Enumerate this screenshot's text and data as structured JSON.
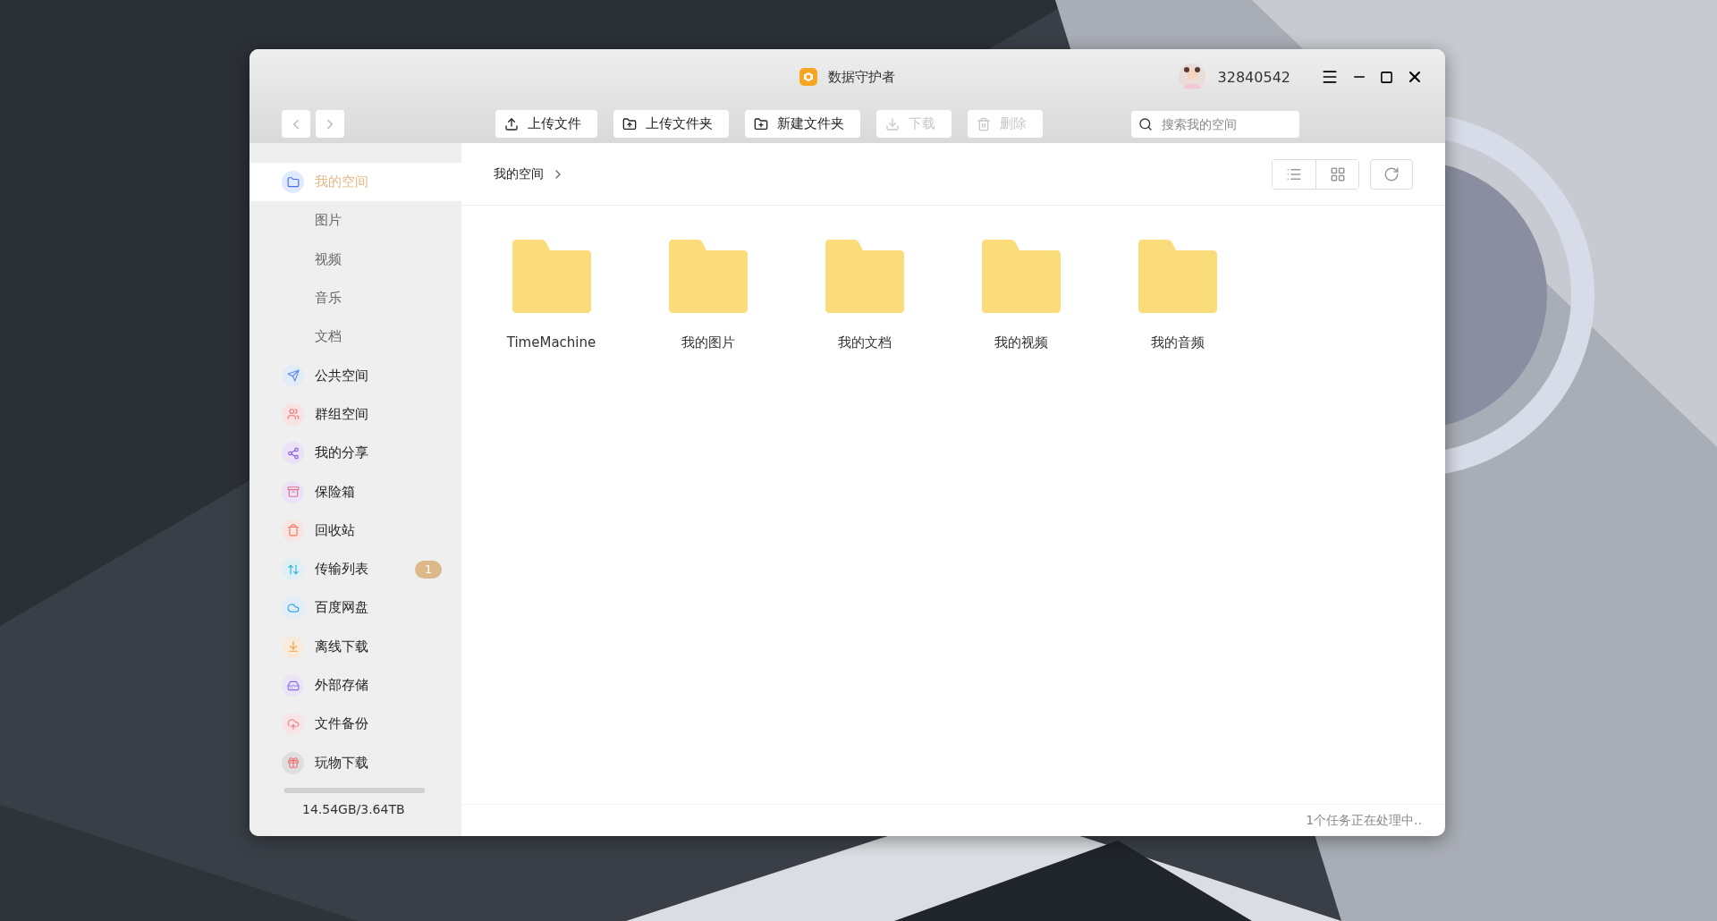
{
  "window": {
    "title": "数据守护者",
    "user": "32840542"
  },
  "toolbar": {
    "buttons": [
      {
        "label": "上传文件",
        "kind": "upload",
        "disabled": false
      },
      {
        "label": "上传文件夹",
        "kind": "upload-folder",
        "disabled": false
      },
      {
        "label": "新建文件夹",
        "kind": "new-folder",
        "disabled": false
      },
      {
        "label": "下载",
        "kind": "download",
        "disabled": true
      },
      {
        "label": "删除",
        "kind": "delete",
        "disabled": true
      }
    ],
    "search": {
      "placeholder": "搜索我的空间"
    }
  },
  "sidebar": {
    "items": [
      {
        "label": "我的空间",
        "selected": true,
        "children": [
          {
            "label": "图片",
            "selected": false
          },
          {
            "label": "视频",
            "selected": false
          },
          {
            "label": "音乐",
            "selected": false
          },
          {
            "label": "文档",
            "selected": false
          }
        ]
      },
      {
        "label": "公共空间",
        "selected": false
      },
      {
        "label": "群组空间",
        "selected": false
      },
      {
        "label": "我的分享",
        "selected": false
      },
      {
        "label": "保险箱",
        "selected": false
      },
      {
        "label": "回收站",
        "selected": false
      },
      {
        "label": "传输列表",
        "selected": false,
        "badge": "1"
      },
      {
        "label": "百度网盘",
        "selected": false
      },
      {
        "label": "离线下载",
        "selected": false
      },
      {
        "label": "外部存储",
        "selected": false
      },
      {
        "label": "文件备份",
        "selected": false
      },
      {
        "label": "玩物下载",
        "selected": false
      }
    ],
    "storage": {
      "level": 0.004,
      "text": "14.54GB/3.64TB"
    }
  },
  "breadcrumb": [
    "我的空间"
  ],
  "folders": [
    "TimeMachine",
    "我的图片",
    "我的文档",
    "我的视频",
    "我的音频"
  ],
  "status_bar": "1个任务正在处理中.."
}
